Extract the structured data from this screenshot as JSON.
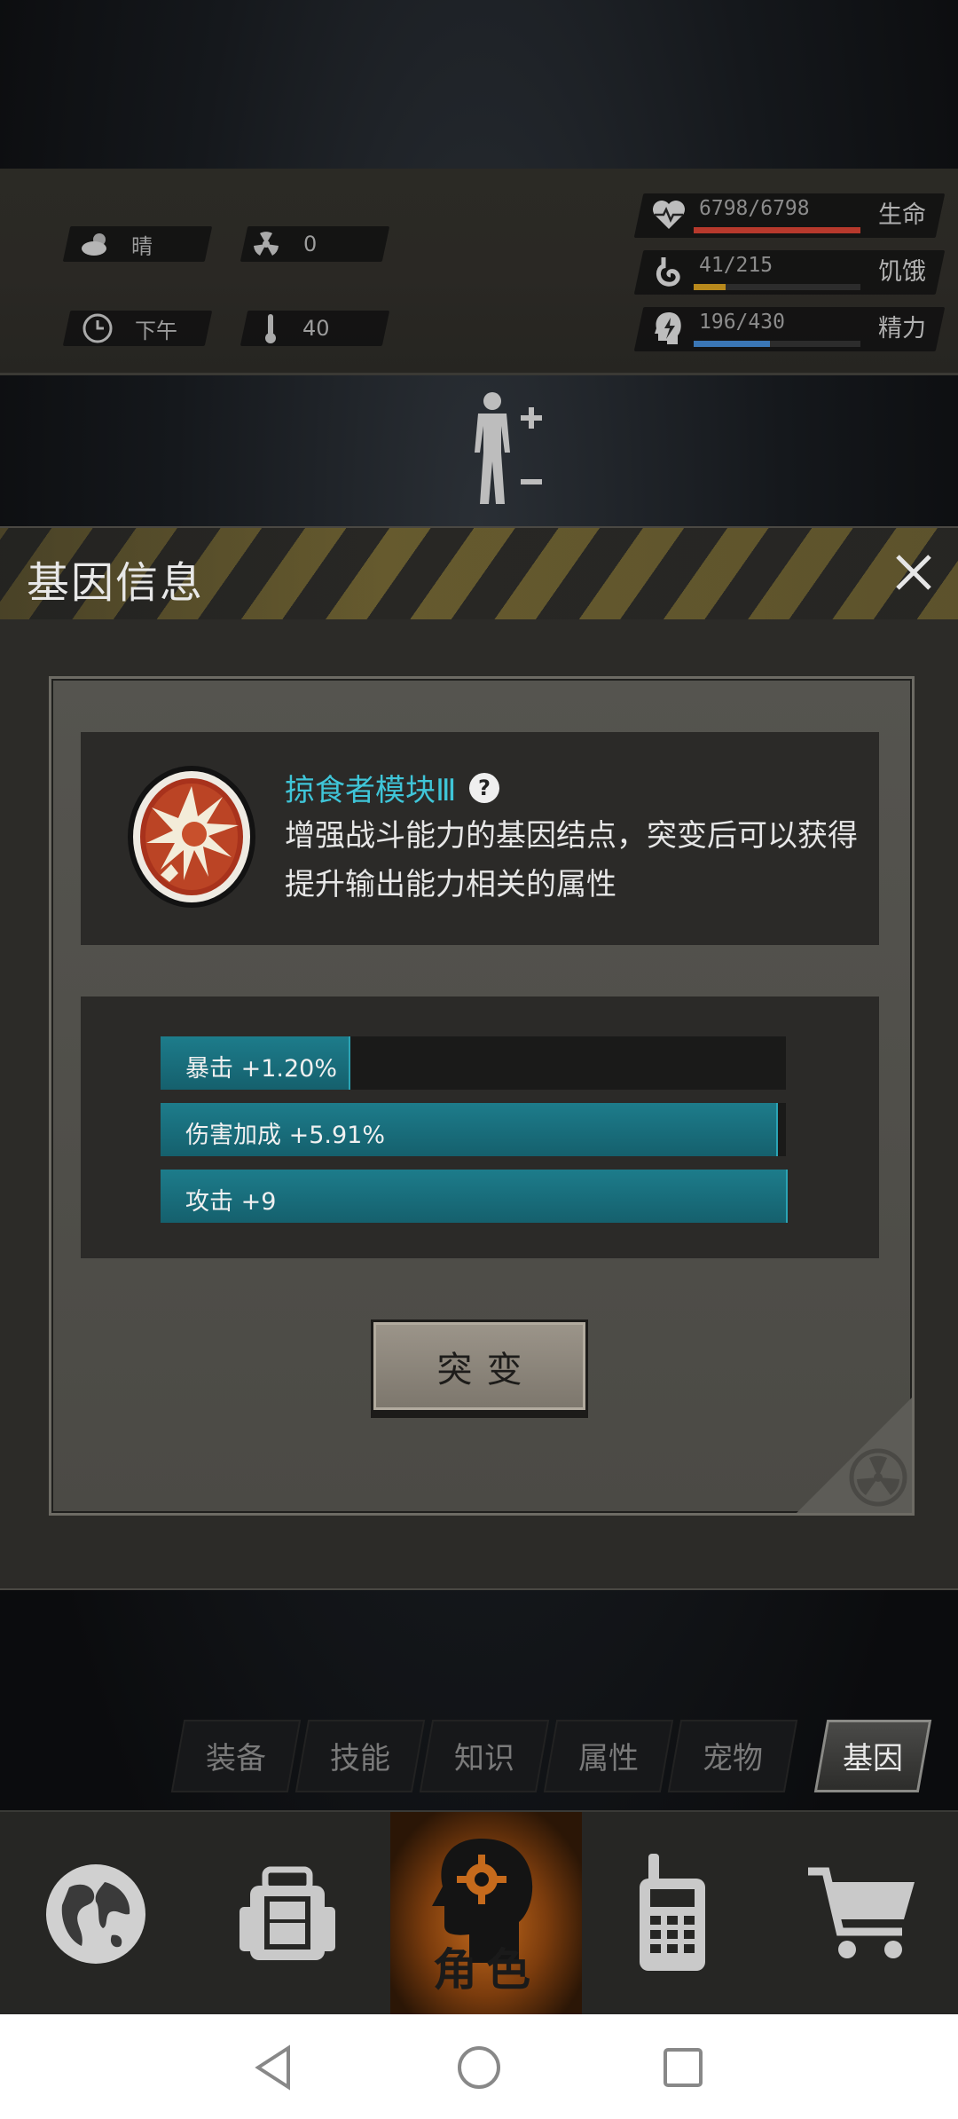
{
  "status": {
    "weather": "晴",
    "radiation": "0",
    "time_of_day": "下午",
    "temperature": "40",
    "health": {
      "value": "6798/6798",
      "label": "生命",
      "fraction": 1.0,
      "color": "#b7392c"
    },
    "hunger": {
      "value": "41/215",
      "label": "饥饿",
      "fraction": 0.19,
      "color": "#b8891c"
    },
    "energy": {
      "value": "196/430",
      "label": "精力",
      "fraction": 0.46,
      "color": "#3a76b5"
    }
  },
  "dialog": {
    "title": "基因信息",
    "gene_name": "掠食者模块Ⅲ",
    "gene_desc": "增强战斗能力的基因结点，突变后可以获得提升输出能力相关的属性",
    "stats": [
      {
        "text": "暴击 +1.20%",
        "fraction": 0.3
      },
      {
        "text": "伤害加成 +5.91%",
        "fraction": 0.985
      },
      {
        "text": "攻击 +9",
        "fraction": 1.0
      }
    ],
    "mutate_label": "突变"
  },
  "tabs": [
    "装备",
    "技能",
    "知识",
    "属性",
    "宠物",
    "基因"
  ],
  "active_tab": "基因",
  "nav": {
    "items": [
      "globe-icon",
      "backpack-icon",
      "character-icon",
      "radio-icon",
      "cart-icon"
    ],
    "active_label": "角色"
  }
}
